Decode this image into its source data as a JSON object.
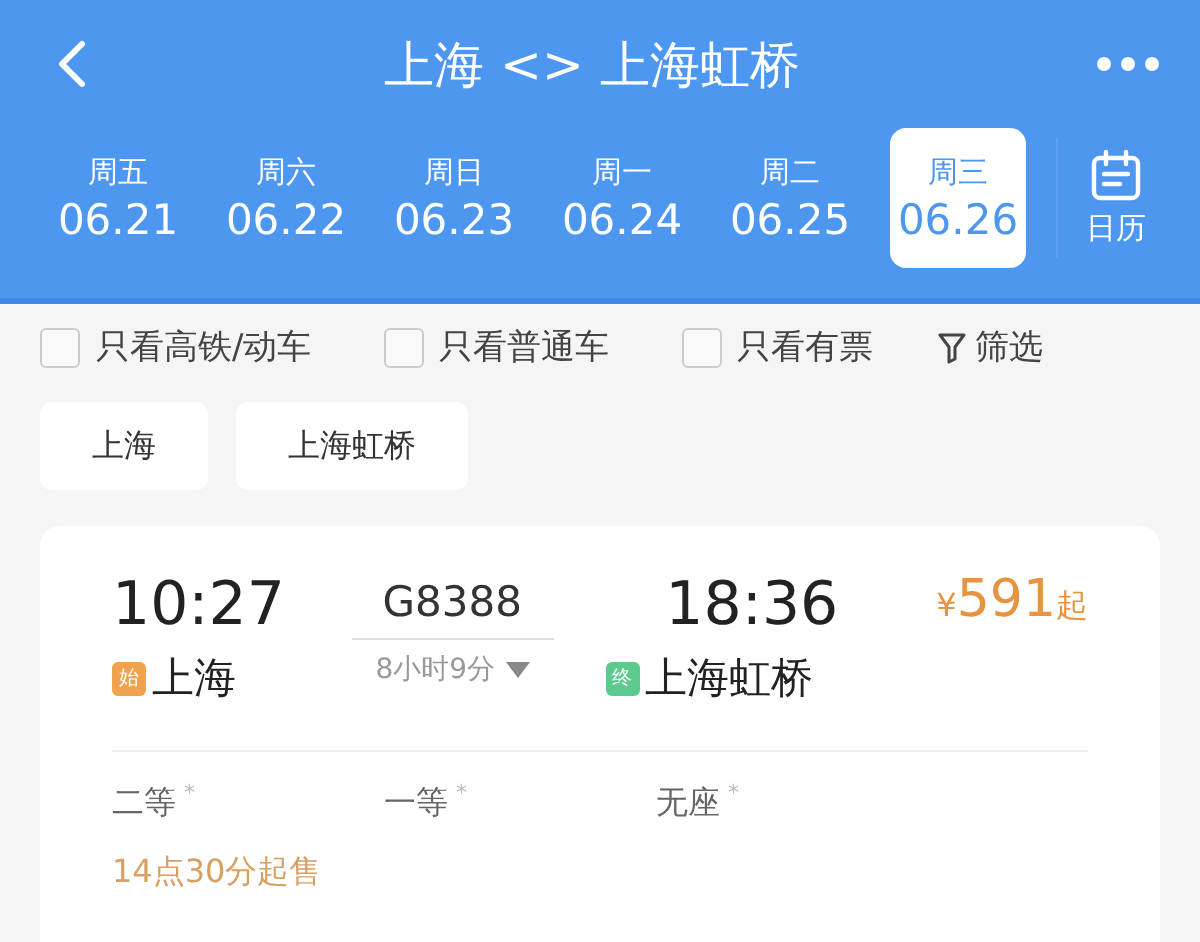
{
  "header": {
    "title": "上海 <> 上海虹桥"
  },
  "dates": [
    {
      "weekday": "周五",
      "date": "06.21",
      "selected": false
    },
    {
      "weekday": "周六",
      "date": "06.22",
      "selected": false
    },
    {
      "weekday": "周日",
      "date": "06.23",
      "selected": false
    },
    {
      "weekday": "周一",
      "date": "06.24",
      "selected": false
    },
    {
      "weekday": "周二",
      "date": "06.25",
      "selected": false
    },
    {
      "weekday": "周三",
      "date": "06.26",
      "selected": true
    }
  ],
  "calendar": {
    "label": "日历"
  },
  "filters": [
    {
      "label": "只看高铁/动车",
      "checked": false
    },
    {
      "label": "只看普通车",
      "checked": false
    },
    {
      "label": "只看有票",
      "checked": false
    }
  ],
  "filter_button": {
    "label": "筛选"
  },
  "stations": [
    "上海",
    "上海虹桥"
  ],
  "train": {
    "depart_time": "10:27",
    "train_no": "G8388",
    "arrive_time": "18:36",
    "price_symbol": "¥",
    "price": "591",
    "price_suffix": "起",
    "depart_badge": "始",
    "depart_station": "上海",
    "duration": "8小时9分",
    "arrive_badge": "终",
    "arrive_station": "上海虹桥",
    "seats": [
      {
        "class": "二等",
        "mark": "*"
      },
      {
        "class": "一等",
        "mark": "*"
      },
      {
        "class": "无座",
        "mark": "*"
      }
    ],
    "sale_note": "14点30分起售"
  }
}
